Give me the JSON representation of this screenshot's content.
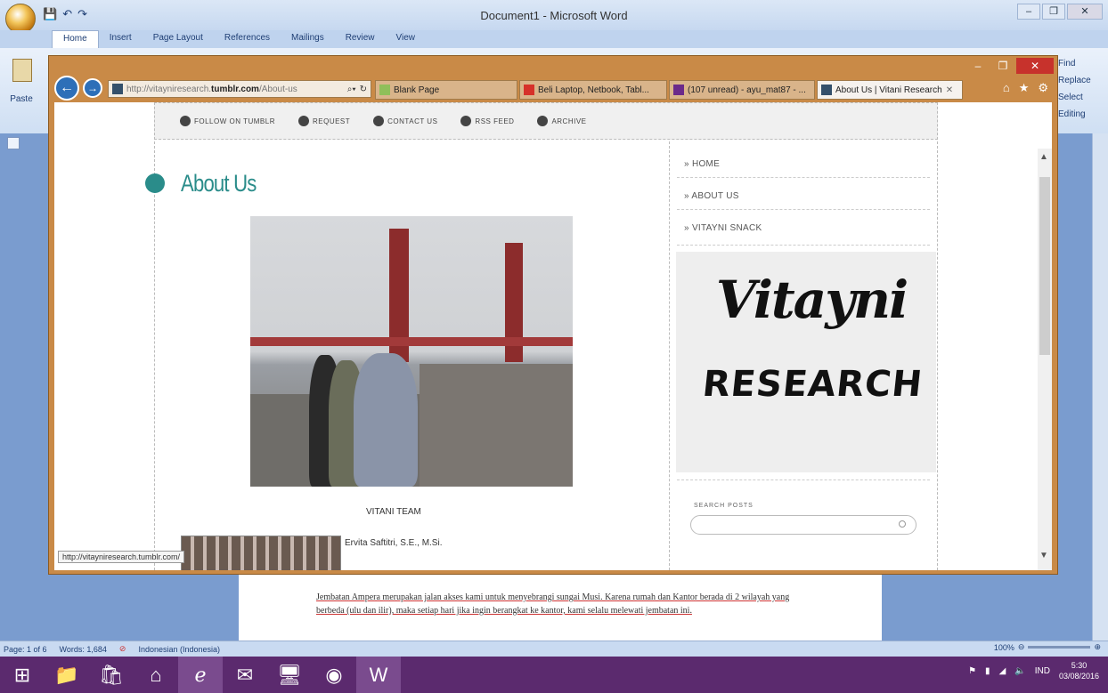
{
  "word": {
    "title": "Document1 - Microsoft Word",
    "tabs": [
      "Home",
      "Insert",
      "Page Layout",
      "References",
      "Mailings",
      "Review",
      "View"
    ],
    "paste_label": "Paste",
    "editing": [
      "Find",
      "Replace",
      "Select",
      "Editing"
    ],
    "doc_text": "Jembatan Ampera merupakan jalan akses kami untuk menyebrangi sungai Musi. Karena rumah dan Kantor berada di 2 wilayah yang berbeda (ulu dan ilir), maka setiap hari jika ingin berangkat ke kantor, kami selalu melewati jembatan ini.",
    "status": {
      "page": "Page: 1 of 6",
      "words": "Words: 1,684",
      "language": "Indonesian (Indonesia)",
      "zoom": "100%"
    }
  },
  "browser": {
    "address_prefix": "http://vitayniresearch.",
    "address_domain": "tumblr.com",
    "address_suffix": "/About-us",
    "tabs": [
      {
        "label": "Blank Page",
        "active": false
      },
      {
        "label": "Beli Laptop, Netbook, Tabl...",
        "active": false
      },
      {
        "label": "(107 unread) - ayu_mat87 - ...",
        "active": false
      },
      {
        "label": "About Us | Vitani Research",
        "active": true
      }
    ],
    "status_url": "http://vitayniresearch.tumblr.com/"
  },
  "blog": {
    "topnav": [
      "FOLLOW ON TUMBLR",
      "REQUEST",
      "CONTACT US",
      "RSS FEED",
      "ARCHIVE"
    ],
    "page_title": "About Us",
    "photo_caption": "VITANI TEAM",
    "member_name": "Ervita Saftitri, S.E., M.Si.",
    "sidebar_links": [
      "HOME",
      "ABOUT US",
      "VITAYNI SNACK"
    ],
    "logo_line1": "Vitayni",
    "logo_line2": "RESEARCH",
    "search_label": "SEARCH POSTS"
  },
  "taskbar": {
    "lang": "IND",
    "time": "5:30",
    "date": "03/08/2016"
  },
  "colors": {
    "ie_frame": "#c98a47",
    "accent_teal": "#2a8c8a",
    "taskbar": "#5b2a6e"
  }
}
